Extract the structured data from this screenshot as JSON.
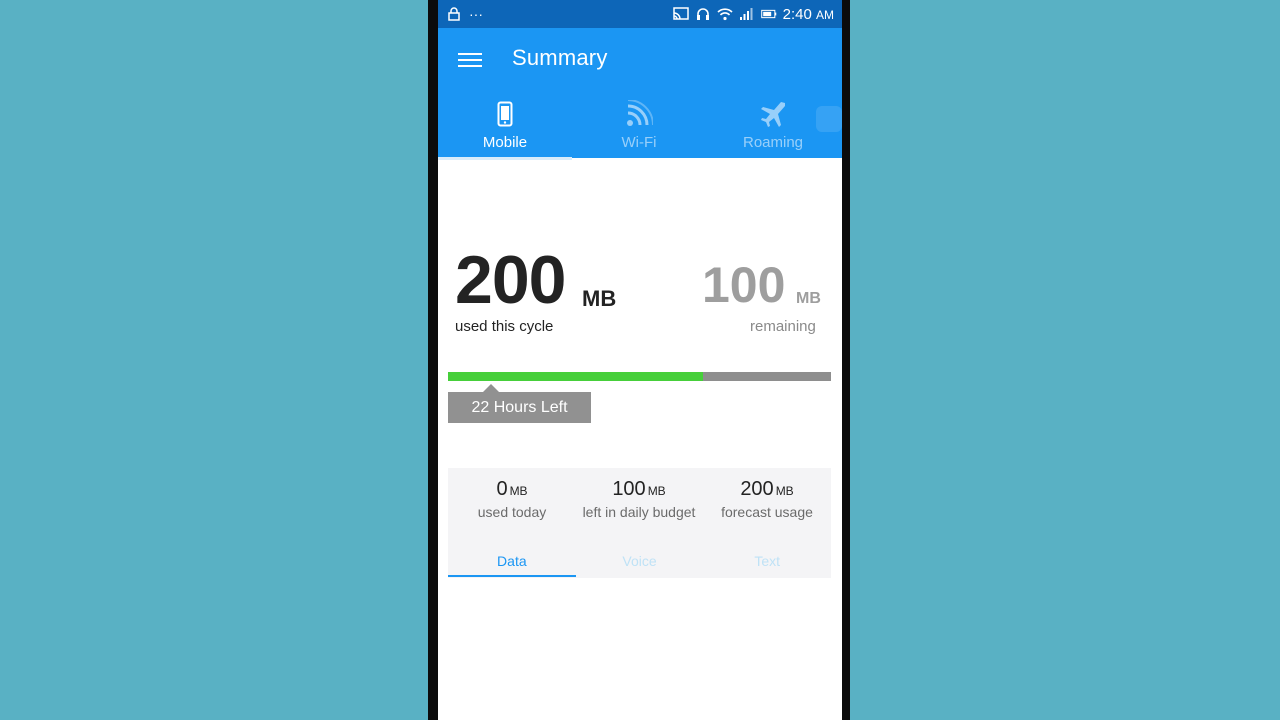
{
  "status_bar": {
    "time": "2:40",
    "ampm": "AM",
    "icons": [
      "cast-icon",
      "headphones-icon",
      "wifi-icon",
      "signal-3g-icon",
      "battery-icon"
    ]
  },
  "app_bar": {
    "title": "Summary",
    "tabs": [
      {
        "label": "Mobile",
        "icon": "phone-icon",
        "active": true
      },
      {
        "label": "Wi-Fi",
        "icon": "wifi-icon",
        "active": false
      },
      {
        "label": "Roaming",
        "icon": "airplane-icon",
        "active": false
      }
    ]
  },
  "usage": {
    "used_value": "200",
    "used_unit": "MB",
    "used_label": "used this cycle",
    "remaining_value": "100",
    "remaining_unit": "MB",
    "remaining_label": "remaining",
    "progress_fraction": 0.667,
    "time_left": "22 Hours Left"
  },
  "stats": [
    {
      "value": "0",
      "unit": "MB",
      "label": "used today"
    },
    {
      "value": "100",
      "unit": "MB",
      "label": "left in daily budget"
    },
    {
      "value": "200",
      "unit": "MB",
      "label": "forecast usage"
    }
  ],
  "sub_tabs": [
    {
      "label": "Data",
      "active": true
    },
    {
      "label": "Voice",
      "active": false
    },
    {
      "label": "Text",
      "active": false
    }
  ],
  "colors": {
    "status_bar": "#0d66b8",
    "app_bar": "#1b96f3",
    "progress_used": "#46cf3a",
    "progress_remaining": "#8e8e8e",
    "background": "#59b1c4"
  }
}
